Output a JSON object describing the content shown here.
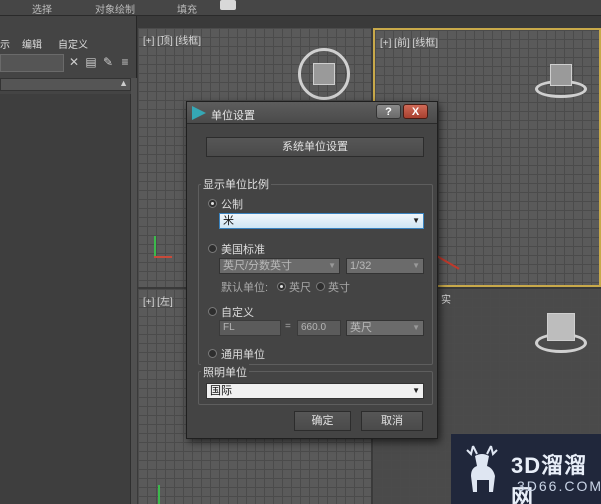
{
  "ribbon": {
    "items": [
      "选择",
      "对象绘制",
      "填充"
    ]
  },
  "left_panel": {
    "menu": [
      "示",
      "编辑",
      "自定义"
    ]
  },
  "viewports": {
    "top": "[+] [顶] [线框]",
    "front": "[+] [前] [线框]",
    "left": "[+] [左]",
    "persp_tag": "实"
  },
  "dialog": {
    "title": "单位设置",
    "help": "?",
    "close": "X",
    "system_units_button": "系统单位设置",
    "display_group": "显示单位比例",
    "metric": {
      "label": "公制",
      "value": "米"
    },
    "us_standard": {
      "label": "美国标准",
      "unit": "英尺/分数英寸",
      "fraction": "1/32"
    },
    "default_units": {
      "label": "默认单位:",
      "feet": "英尺",
      "inches": "英寸"
    },
    "custom": {
      "label": "自定义",
      "symbol": "FL",
      "equals": "=",
      "value": "660.0",
      "unit": "英尺"
    },
    "generic": {
      "label": "通用单位"
    },
    "lighting_group": "照明单位",
    "lighting_value": "国际",
    "ok": "确定",
    "cancel": "取消"
  },
  "watermark": {
    "line1": "3D溜溜网",
    "line2": "3D66.COM"
  },
  "colors": {
    "accent_viewport": "#c8a94a",
    "dropdown_active": "#cfe6f4",
    "close_button": "#a8402f",
    "annotation_line": "#c0392b"
  }
}
